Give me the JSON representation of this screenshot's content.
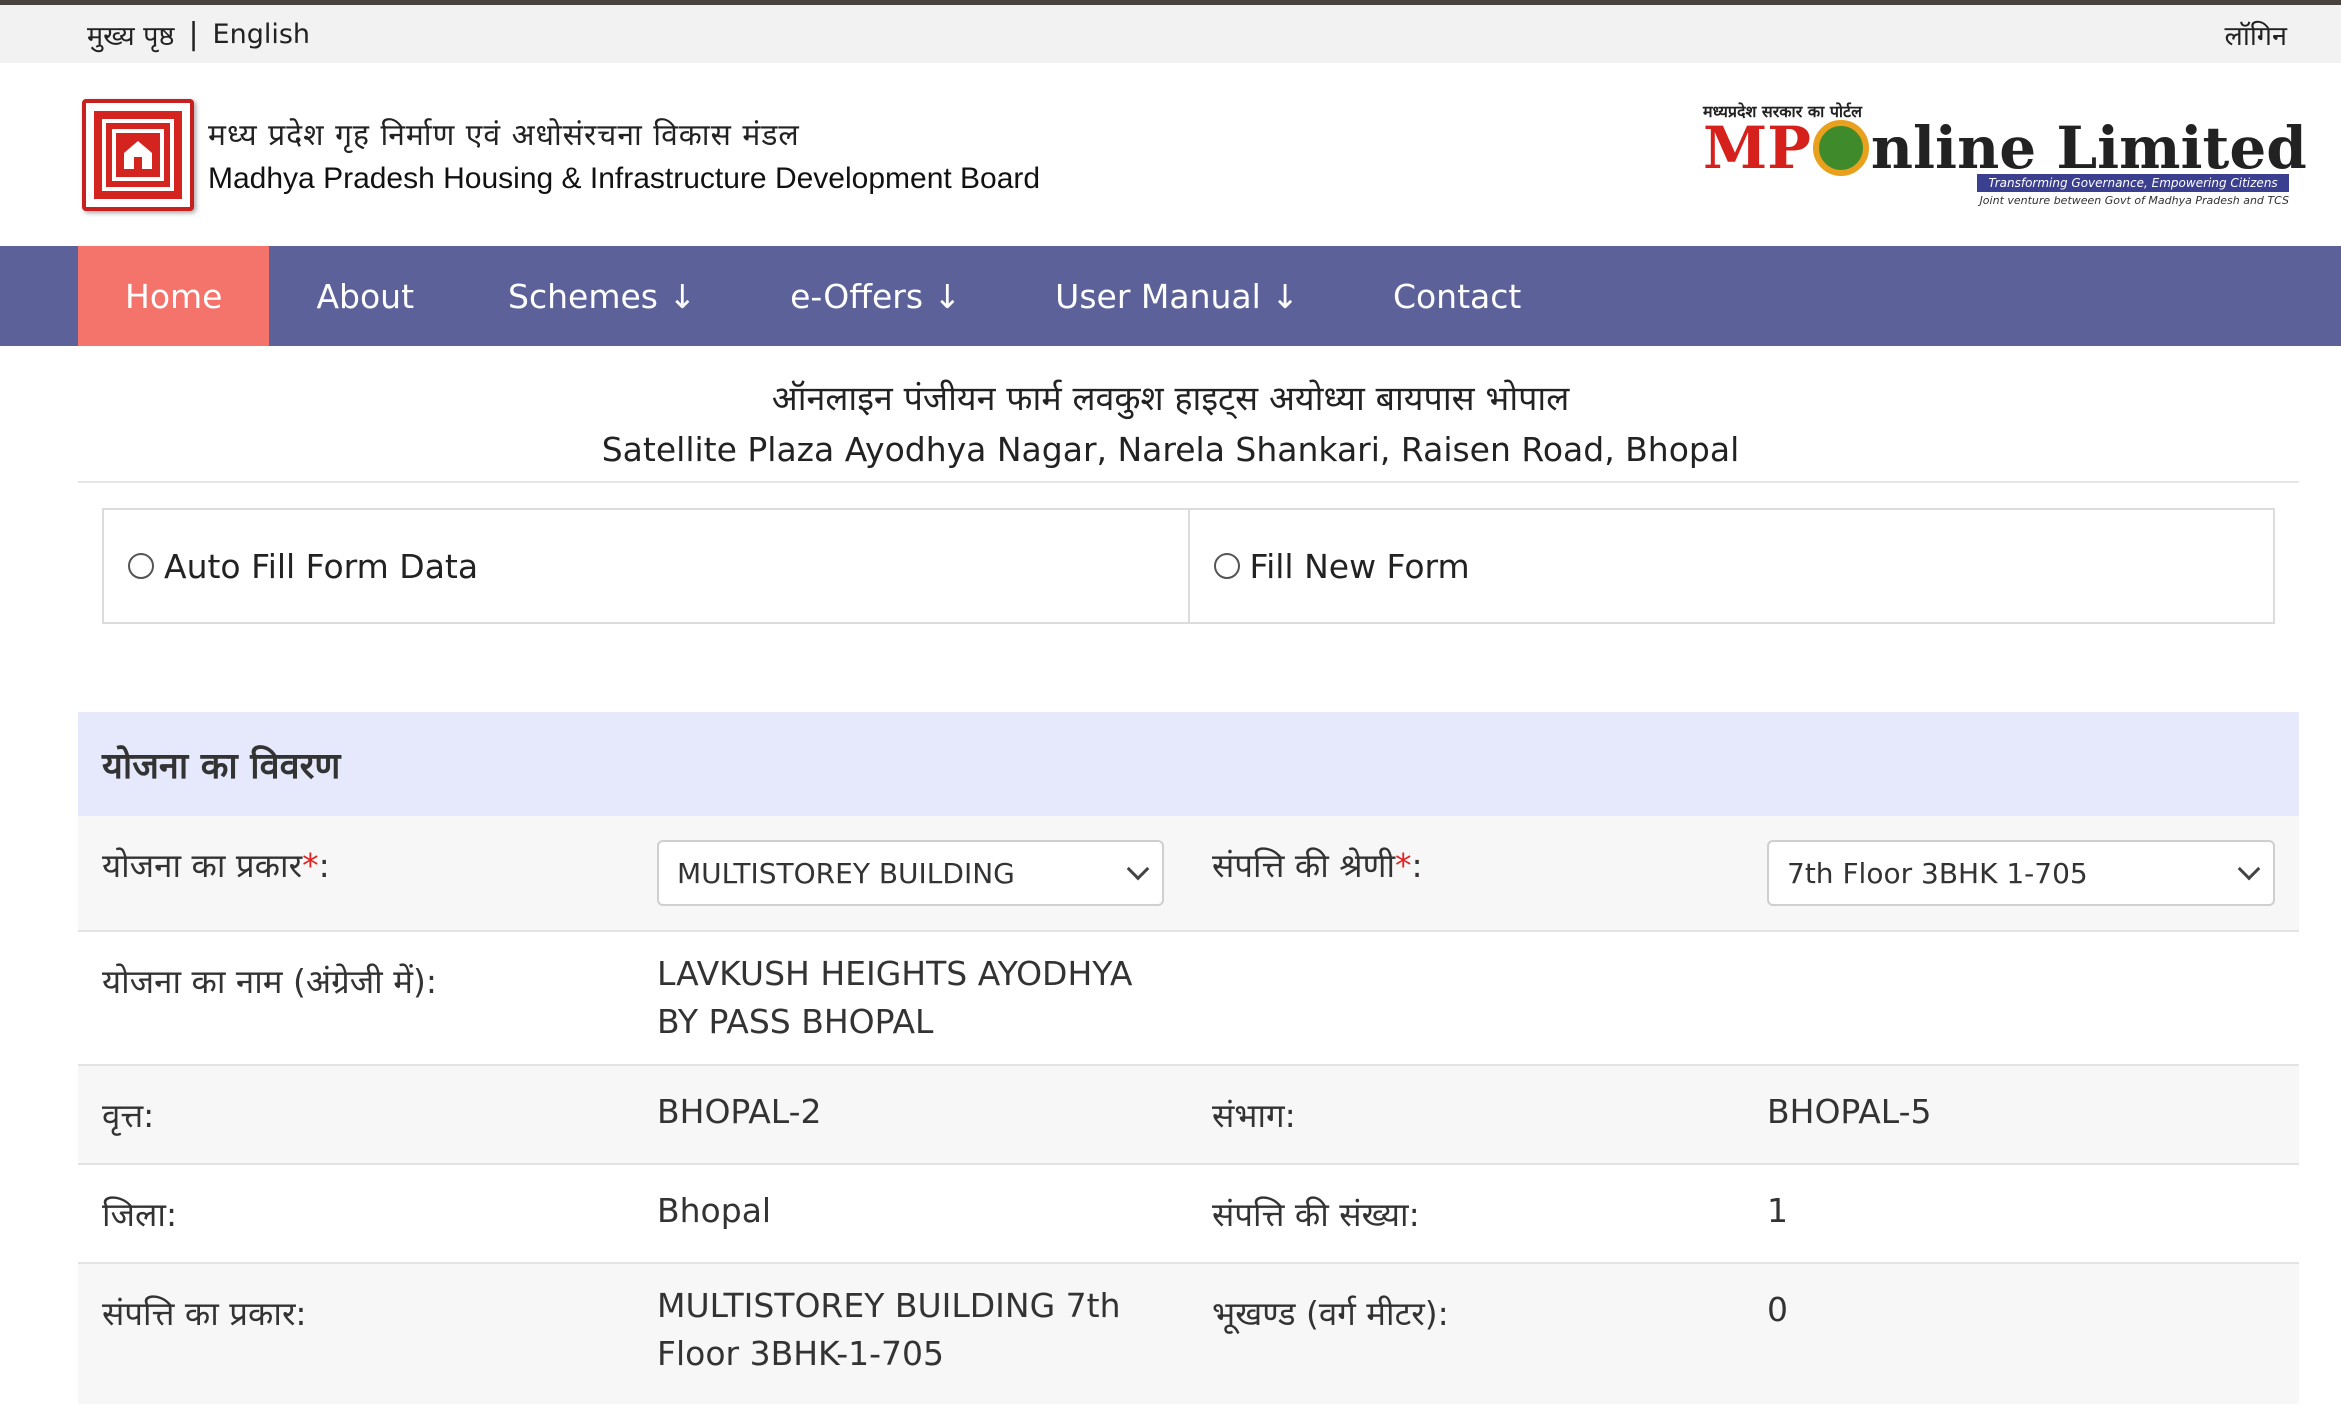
{
  "topbar": {
    "home_link": "मुख्य पृष्ठ",
    "separator": "|",
    "lang_link": "English",
    "login_link": "लॉगिन"
  },
  "header": {
    "org_hindi": "मध्य प्रदेश गृह निर्माण एवं अधोसंरचना विकास मंडल",
    "org_english": "Madhya Pradesh Housing & Infrastructure Development Board",
    "portal_caption": "मध्यप्रदेश सरकार का पोर्टल",
    "mponline_mp": "MP",
    "mponline_rest": "nline Limited",
    "mponline_tagline": "Transforming Governance, Empowering Citizens",
    "mponline_jv": "Joint venture between Govt of Madhya Pradesh and TCS"
  },
  "nav": {
    "items": [
      {
        "label": "Home",
        "active": true
      },
      {
        "label": "About"
      },
      {
        "label": "Schemes ↓"
      },
      {
        "label": "e-Offers ↓"
      },
      {
        "label": "User Manual ↓"
      },
      {
        "label": "Contact"
      }
    ]
  },
  "page": {
    "title_hindi": "ऑनलाइन पंजीयन फार्म लवकुश हाइट्स अयोध्या बायपास भोपाल",
    "title_english": "Satellite Plaza Ayodhya Nagar, Narela Shankari, Raisen Road, Bhopal"
  },
  "form_mode": {
    "option_autofill": "Auto Fill Form Data",
    "option_new": "Fill New Form"
  },
  "scheme": {
    "section_title": "योजना का विवरण",
    "type_label": "योजना का प्रकार",
    "type_value": "MULTISTOREY BUILDING",
    "category_label": "संपत्ति की श्रेणी",
    "category_value": "7th Floor 3BHK 1-705",
    "required_mark": "*",
    "colon": ":",
    "name_label": "योजना का नाम (अंग्रेजी में):",
    "name_value": "LAVKUSH HEIGHTS AYODHYA BY PASS BHOPAL",
    "circle_label": "वृत्त:",
    "circle_value": "BHOPAL-2",
    "division_label": "संभाग:",
    "division_value": "BHOPAL-5",
    "district_label": "जिला:",
    "district_value": "Bhopal",
    "property_count_label": "संपत्ति की संख्या:",
    "property_count_value": "1",
    "property_type_label": "संपत्ति का प्रकार:",
    "property_type_value": "MULTISTOREY BUILDING 7th Floor 3BHK-1-705",
    "plot_area_label": "भूखण्ड (वर्ग मीटर):",
    "plot_area_value": "0"
  },
  "colors": {
    "nav_bg": "#5c6299",
    "nav_active": "#f4736a",
    "section_head_bg": "#e6e9fb",
    "required": "#e02424",
    "brand_red": "#c8201e"
  }
}
